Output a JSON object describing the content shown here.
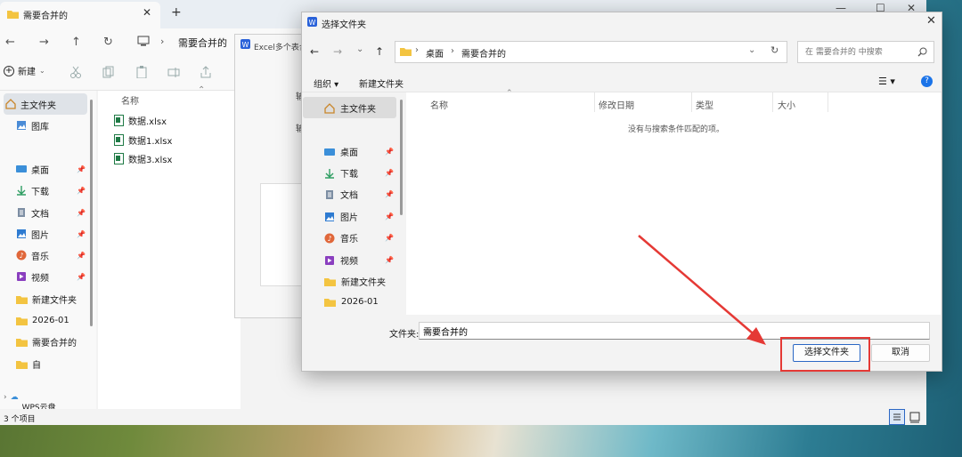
{
  "explorer": {
    "tab_title": "需要合并的",
    "breadcrumb": "需要合并的",
    "new_button": "新建",
    "sidebar": {
      "home": "主文件夹",
      "gallery": "图库",
      "items": [
        {
          "label": "桌面",
          "icon": "desktop-icon",
          "pinned": true
        },
        {
          "label": "下载",
          "icon": "download-icon",
          "pinned": true
        },
        {
          "label": "文档",
          "icon": "document-icon",
          "pinned": true
        },
        {
          "label": "图片",
          "icon": "picture-icon",
          "pinned": true
        },
        {
          "label": "音乐",
          "icon": "music-icon",
          "pinned": true
        },
        {
          "label": "视频",
          "icon": "video-icon",
          "pinned": true
        },
        {
          "label": "新建文件夹",
          "icon": "folder-icon",
          "pinned": false
        },
        {
          "label": "2026-01",
          "icon": "folder-icon",
          "pinned": false
        },
        {
          "label": "需要合并的",
          "icon": "folder-icon",
          "pinned": false
        },
        {
          "label": "自",
          "icon": "folder-icon",
          "pinned": false
        }
      ],
      "wps_cloud": "WPS云盘"
    },
    "column_name": "名称",
    "files": [
      "数据.xlsx",
      "数据1.xlsx",
      "数据3.xlsx"
    ],
    "status": "3 个项目"
  },
  "wps_dialog": {
    "title": "Excel多个表合",
    "label1": "输",
    "label2": "输"
  },
  "dialog": {
    "title": "选择文件夹",
    "breadcrumb": [
      "桌面",
      "需要合并的"
    ],
    "search_placeholder": "在 需要合并的 中搜索",
    "organize": "组织 ▾",
    "new_folder": "新建文件夹",
    "nav": {
      "home": "主文件夹",
      "items": [
        {
          "label": "桌面",
          "icon": "desktop-icon",
          "pinned": true
        },
        {
          "label": "下载",
          "icon": "download-icon",
          "pinned": true
        },
        {
          "label": "文档",
          "icon": "document-icon",
          "pinned": true
        },
        {
          "label": "图片",
          "icon": "picture-icon",
          "pinned": true
        },
        {
          "label": "音乐",
          "icon": "music-icon",
          "pinned": true
        },
        {
          "label": "视频",
          "icon": "video-icon",
          "pinned": true
        },
        {
          "label": "新建文件夹",
          "icon": "folder-icon",
          "pinned": false
        },
        {
          "label": "2026-01",
          "icon": "folder-icon",
          "pinned": false
        }
      ]
    },
    "columns": [
      "名称",
      "修改日期",
      "类型",
      "大小"
    ],
    "empty_message": "没有与搜索条件匹配的项。",
    "folder_label": "文件夹:",
    "folder_value": "需要合并的",
    "select_button": "选择文件夹",
    "cancel_button": "取消",
    "annotation_color": "#e53935"
  }
}
